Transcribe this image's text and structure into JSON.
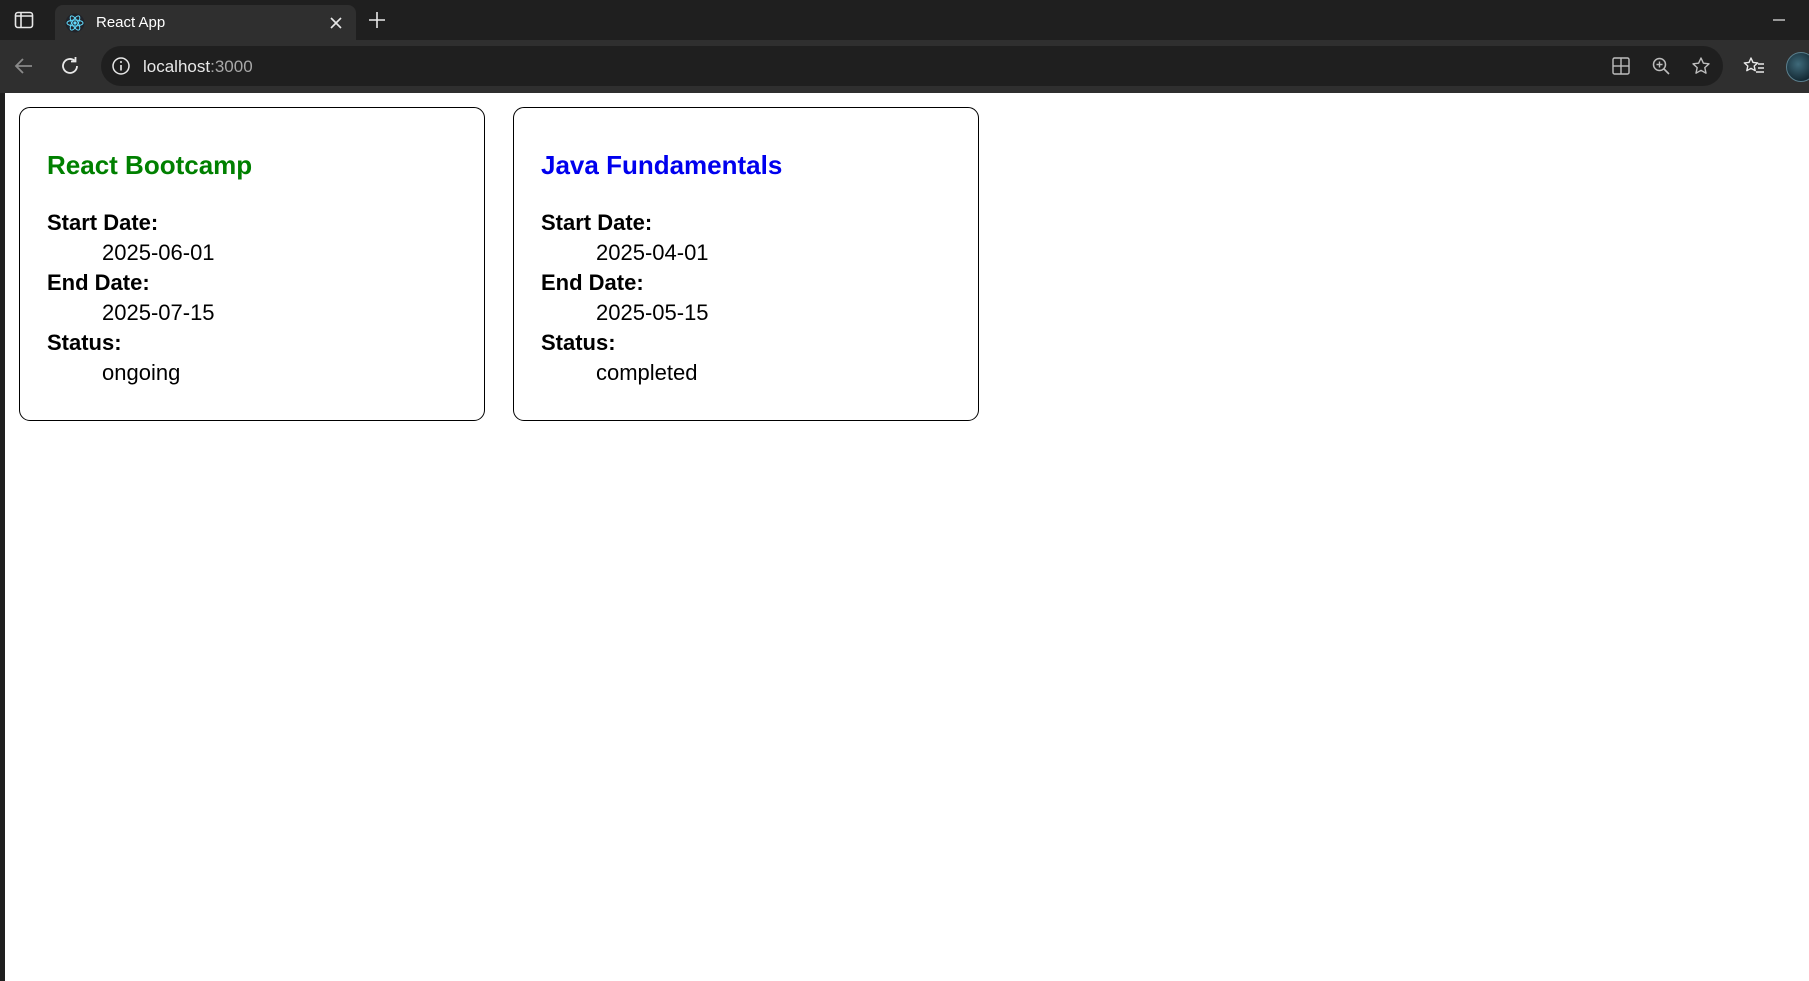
{
  "browser": {
    "tab": {
      "title": "React App",
      "favicon": "react-logo-icon"
    },
    "url": {
      "host": "localhost",
      "port": ":3000"
    },
    "icons": {
      "tab_actions": "tab-actions-icon",
      "close": "close-icon",
      "new_tab": "plus-icon",
      "minimize": "minimize-icon",
      "back": "back-arrow-icon",
      "reload": "reload-icon",
      "site_info": "info-icon",
      "apps": "apps-icon",
      "zoom": "zoom-icon",
      "favorite": "star-icon",
      "favorites": "favorites-icon"
    }
  },
  "courses": [
    {
      "name": "React Bootcamp",
      "name_color": "#008000",
      "start_label": "Start Date:",
      "start_value": "2025-06-01",
      "end_label": "End Date:",
      "end_value": "2025-07-15",
      "status_label": "Status:",
      "status_value": "ongoing"
    },
    {
      "name": "Java Fundamentals",
      "name_color": "#0000ee",
      "start_label": "Start Date:",
      "start_value": "2025-04-01",
      "end_label": "End Date:",
      "end_value": "2025-05-15",
      "status_label": "Status:",
      "status_value": "completed"
    }
  ]
}
